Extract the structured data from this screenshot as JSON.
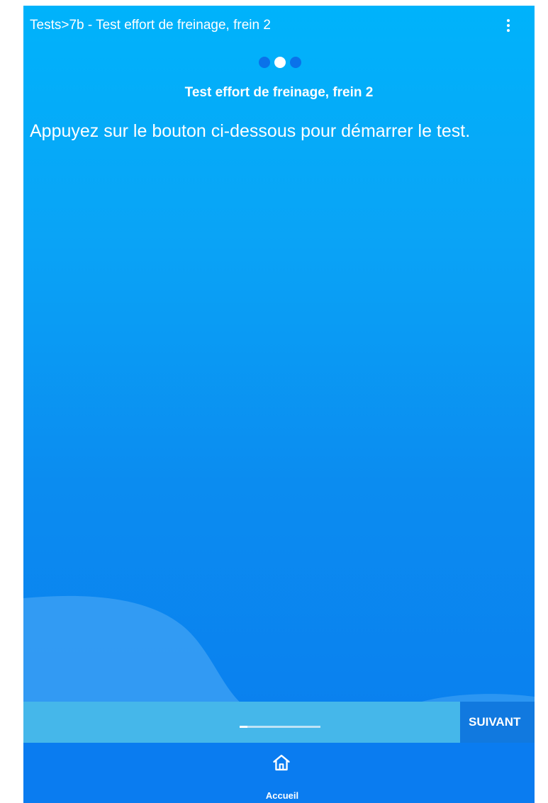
{
  "header": {
    "breadcrumb": "Tests>7b - Test effort de freinage, frein 2",
    "menu_icon": "more-vert-icon"
  },
  "stepper": {
    "total_steps": 3,
    "active_step": 2
  },
  "content": {
    "title": "Test effort de freinage, frein 2",
    "instruction": "Appuyez sur le bouton ci-dessous pour démarrer le test."
  },
  "footer": {
    "progress": 0.1,
    "next_label": "SUIVANT"
  },
  "bottom_nav": {
    "items": [
      {
        "label": "Accueil",
        "icon": "home-icon"
      }
    ]
  },
  "colors": {
    "background_top": "#00b3fb",
    "background_bottom": "#0a7cee",
    "progress_strip": "#45b7ea",
    "next_button": "#1179df",
    "bottom_nav": "#0a7cf0",
    "dot_inactive": "#0a72ea",
    "dot_active": "#ffffff"
  }
}
